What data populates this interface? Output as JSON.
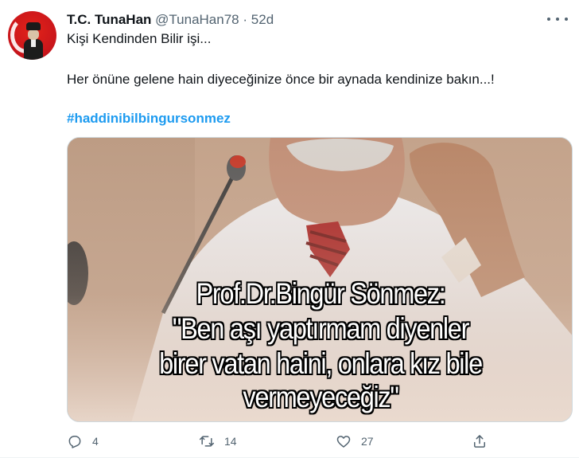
{
  "tweet": {
    "author_name": "T.C. TunaHan",
    "author_handle": "@TunaHan78",
    "separator": "·",
    "timestamp": "52d",
    "text_line_1": "Kişi Kendinden Bilir işi...",
    "text_line_2": "Her önüne gelene hain diyeceğinize önce bir aynada kendinize bakın...!",
    "hashtag": "#haddinibilbingursonmez",
    "media": {
      "caption_1": "Prof.Dr.Bingür Sönmez:",
      "caption_2": "\"Ben aşı yaptırmam diyenler",
      "caption_3": "birer vatan haini, onlara kız bile",
      "caption_4": "vermeyeceğiz\""
    },
    "actions": {
      "reply_count": "4",
      "retweet_count": "14",
      "like_count": "27"
    }
  },
  "icons": [
    "more-icon",
    "reply-icon",
    "retweet-icon",
    "like-icon",
    "share-icon"
  ],
  "colors": {
    "hashtag": "#1d9bf0",
    "secondary_text": "#536471",
    "primary_text": "#0f1419",
    "avatar_red": "#e2231a"
  }
}
